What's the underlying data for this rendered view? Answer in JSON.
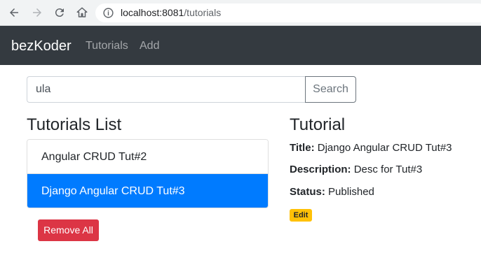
{
  "browser": {
    "url_host": "localhost:8081",
    "url_path": "/tutorials"
  },
  "navbar": {
    "brand": "bezKoder",
    "links": [
      "Tutorials",
      "Add"
    ]
  },
  "search": {
    "value": "ula",
    "button_label": "Search"
  },
  "list": {
    "heading": "Tutorials List",
    "items": [
      "Angular CRUD Tut#2",
      "Django Angular CRUD Tut#3"
    ],
    "active_index": 1,
    "remove_all_label": "Remove All"
  },
  "detail": {
    "heading": "Tutorial",
    "title_label": "Title:",
    "title_value": "Django Angular CRUD Tut#3",
    "description_label": "Description:",
    "description_value": "Desc for Tut#3",
    "status_label": "Status:",
    "status_value": "Published",
    "edit_label": "Edit"
  },
  "colors": {
    "navbar": "#343a40",
    "active_item": "#007bff",
    "danger": "#dc3545",
    "warning": "#ffc107"
  }
}
